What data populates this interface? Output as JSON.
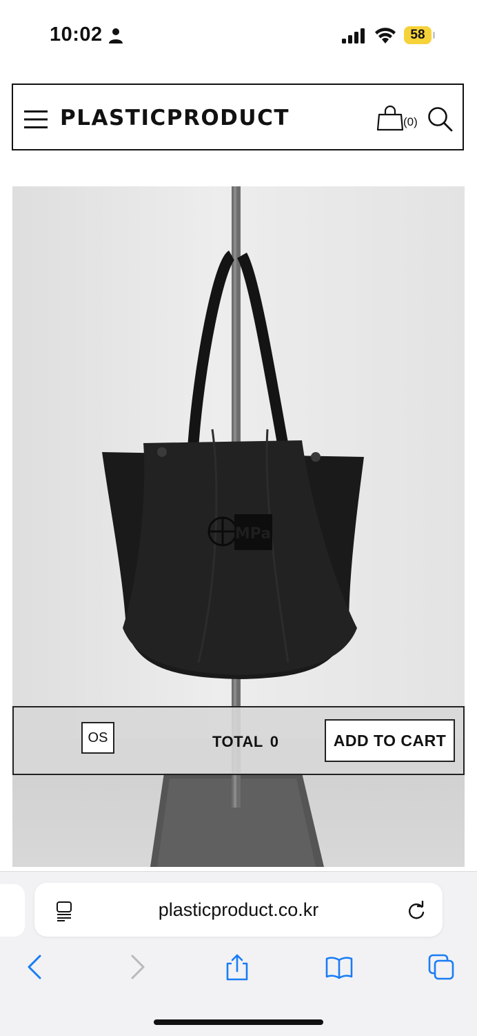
{
  "status_bar": {
    "time": "10:02",
    "battery": "58"
  },
  "header": {
    "brand": "PLASTICPRODUCT",
    "cart_count": "(0)",
    "icons": [
      "menu-icon",
      "shopping-bag-icon",
      "search-icon"
    ]
  },
  "product": {
    "image_subject": "black tote bag hanging on a stand",
    "logo_text": "MPa"
  },
  "purchase_bar": {
    "size_option": "OS",
    "total_label": "TOTAL",
    "total_value": "0",
    "add_to_cart_label": "ADD TO CART"
  },
  "browser": {
    "url": "plasticproduct.co.kr",
    "toolbar_icons": [
      "back-icon",
      "forward-icon",
      "share-icon",
      "bookmarks-icon",
      "tabs-icon"
    ]
  },
  "colors": {
    "accent": "#1a7cf5",
    "battery": "#f6d23a"
  }
}
